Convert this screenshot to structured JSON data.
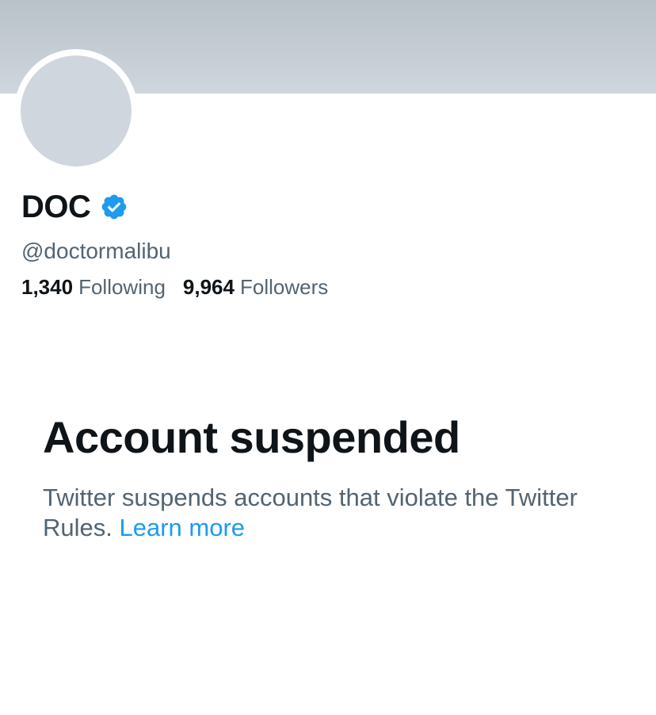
{
  "profile": {
    "display_name": "DOC",
    "handle": "@doctormalibu",
    "verified_icon": "verified-badge-icon",
    "following_count": "1,340",
    "following_label": "Following",
    "followers_count": "9,964",
    "followers_label": "Followers"
  },
  "suspension": {
    "title": "Account suspended",
    "message": "Twitter suspends accounts that violate the Twitter Rules.",
    "link_label": "Learn more"
  },
  "colors": {
    "accent": "#1d9bf0",
    "banner": "#c4ccd3",
    "avatar_placeholder": "#cfd6dd",
    "primary_text": "#0f1419",
    "secondary_text": "#536471"
  }
}
